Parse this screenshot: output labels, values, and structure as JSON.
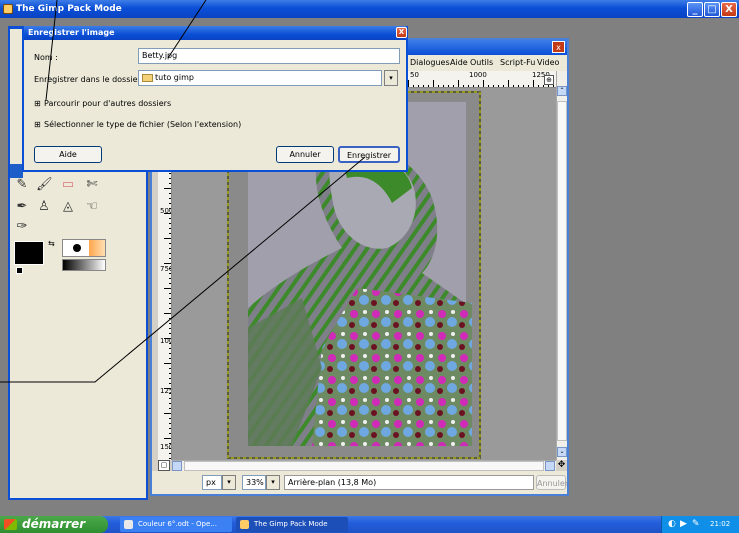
{
  "main_window": {
    "title": "The Gimp Pack Mode",
    "minimize": "_",
    "maximize": "□",
    "close": "X"
  },
  "image_window": {
    "close": "x",
    "menu": [
      "Dialogues",
      "Aide",
      "Outils",
      "Script-Fu",
      "Video"
    ],
    "hruler_labels": [
      "50",
      "1000",
      "1250"
    ],
    "vruler_labels": [
      "500",
      "750",
      "1000",
      "1250",
      "1500"
    ],
    "status": {
      "unit": "px",
      "zoom": "33%",
      "layer": "Arrière-plan (13,8 Mo)",
      "cancel": "Annuler"
    }
  },
  "dialog": {
    "title": "Enregistrer l'image",
    "close": "X",
    "name_label": "Nom :",
    "name_value": "Betty.jpg",
    "folder_label": "Enregistrer dans le dossier :",
    "folder_value": "tuto gimp",
    "browse_label": "Parcourir pour d'autres dossiers",
    "filetype_label": "Sélectionner le type de fichier (Selon l'extension)",
    "help_button": "Aide",
    "cancel_button": "Annuler",
    "save_button": "Enregistrer"
  },
  "taskbar": {
    "start": "démarrer",
    "tasks": [
      "Couleur 6°.odt - Ope...",
      "The Gimp Pack Mode"
    ],
    "clock": "21:02"
  },
  "colors": {
    "title_blue": "#0a4fd6",
    "canvas_bg": "#808080",
    "start_green": "#2f8e2f"
  }
}
